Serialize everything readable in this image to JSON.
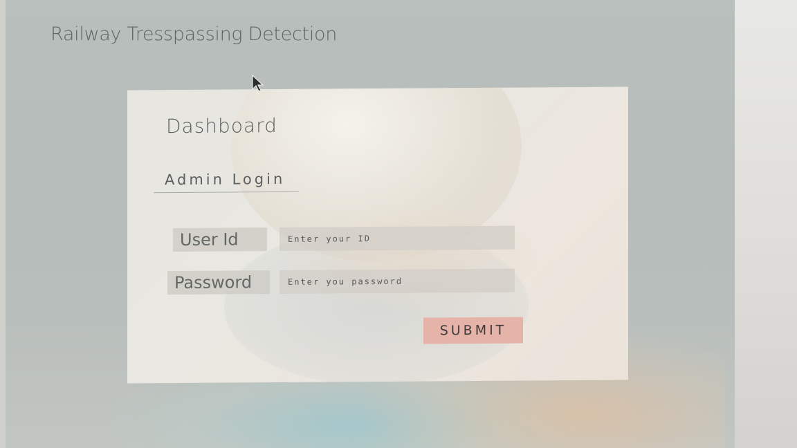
{
  "app": {
    "title": "Railway Tresspassing Detection"
  },
  "panel": {
    "heading": "Dashboard",
    "subheading": "Admin Login"
  },
  "form": {
    "user_id_label": "User Id",
    "user_id_placeholder": "Enter your ID",
    "password_label": "Password",
    "password_placeholder": "Enter you password",
    "submit_label": "SUBMIT"
  },
  "colors": {
    "background": "#b9bfbd",
    "panel": "#e9e7e1",
    "submit_button": "#e6b3a9",
    "text": "#5a5f5e"
  },
  "icons": {
    "cursor": "mouse-pointer-icon"
  }
}
